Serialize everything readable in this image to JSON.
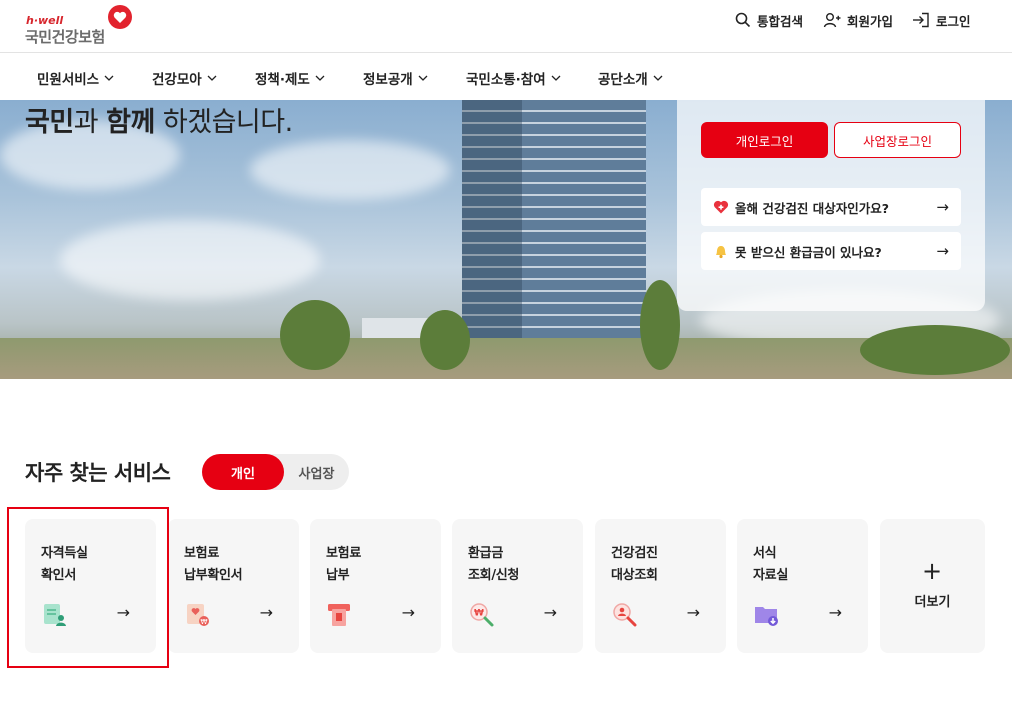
{
  "header": {
    "logo_sub": "h·well",
    "logo_main": "국민건강보험",
    "utils": [
      {
        "label": "통합검색",
        "icon": "search-icon"
      },
      {
        "label": "회원가입",
        "icon": "user-plus-icon"
      },
      {
        "label": "로그인",
        "icon": "login-icon"
      }
    ]
  },
  "nav": {
    "items": [
      {
        "label": "민원서비스"
      },
      {
        "label": "건강모아"
      },
      {
        "label": "정책·제도"
      },
      {
        "label": "정보공개"
      },
      {
        "label": "국민소통·참여"
      },
      {
        "label": "공단소개"
      }
    ]
  },
  "hero": {
    "text_bold1": "국민",
    "text_part1": "과 ",
    "text_bold2": "함께",
    "text_part2": " 하겠습니다."
  },
  "login": {
    "personal": "개인로그인",
    "business": "사업장로그인",
    "quick": [
      {
        "label": "올해 건강검진 대상자인가요?",
        "icon": "heart-plus-icon",
        "arrow": "→"
      },
      {
        "label": "못 받으신 환급금이 있나요?",
        "icon": "bell-icon",
        "arrow": "→"
      }
    ]
  },
  "services": {
    "title": "자주 찾는 서비스",
    "toggle_on": "개인",
    "toggle_off": "사업장",
    "cards": [
      {
        "line1": "자격득실",
        "line2": "확인서",
        "icon": "document-person-icon",
        "arrow": "→"
      },
      {
        "line1": "보험료",
        "line2": "납부확인서",
        "icon": "document-heart-icon",
        "arrow": "→"
      },
      {
        "line1": "보험료",
        "line2": "납부",
        "icon": "atm-icon",
        "arrow": "→"
      },
      {
        "line1": "환급금",
        "line2": "조회/신청",
        "icon": "search-won-icon",
        "arrow": "→"
      },
      {
        "line1": "건강검진",
        "line2": "대상조회",
        "icon": "search-person-icon",
        "arrow": "→"
      },
      {
        "line1": "서식",
        "line2": "자료실",
        "icon": "folder-download-icon",
        "arrow": "→"
      }
    ],
    "more_label": "더보기",
    "more_icon": "+"
  },
  "colors": {
    "accent": "#e60012",
    "card_bg": "#f6f6f6"
  }
}
